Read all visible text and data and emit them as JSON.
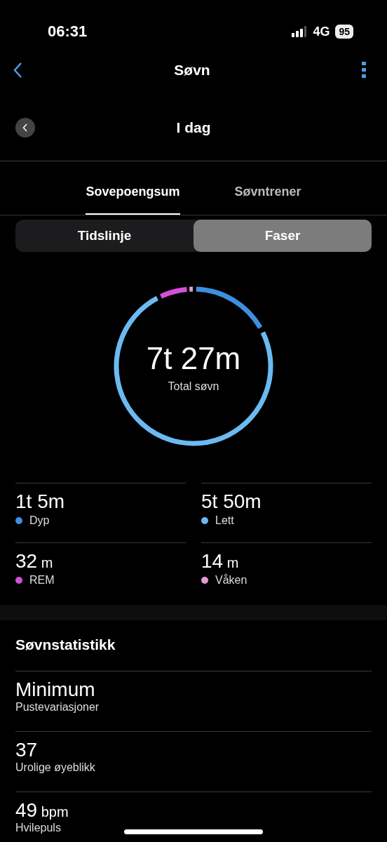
{
  "status_bar": {
    "time": "06:31",
    "network": "4G",
    "battery": "95"
  },
  "nav": {
    "title": "Søvn"
  },
  "date_bar": {
    "title": "I dag"
  },
  "tabs": [
    {
      "label": "Sovepoengsum",
      "selected": true
    },
    {
      "label": "Søvntrener",
      "selected": false
    }
  ],
  "segments": [
    {
      "label": "Tidslinje",
      "selected": false
    },
    {
      "label": "Faser",
      "selected": true
    }
  ],
  "total": {
    "value": "7t 27m",
    "label": "Total søvn"
  },
  "stages": [
    {
      "value": "1t 5m",
      "name": "Dyp",
      "color": "#3d8fe0"
    },
    {
      "value": "5t 50m",
      "name": "Lett",
      "color": "#6bbaf2"
    },
    {
      "value": "32",
      "unit": "m",
      "name": "REM",
      "color": "#d54fd6"
    },
    {
      "value": "14",
      "unit": "m",
      "name": "Våken",
      "color": "#e59ad8"
    }
  ],
  "stats": {
    "title": "Søvnstatistikk",
    "items": [
      {
        "value": "Minimum",
        "label": "Pustevariasjoner"
      },
      {
        "value": "37",
        "label": "Urolige øyeblikk"
      },
      {
        "value": "49",
        "unit": "bpm",
        "label": "Hvilepuls"
      }
    ]
  }
}
